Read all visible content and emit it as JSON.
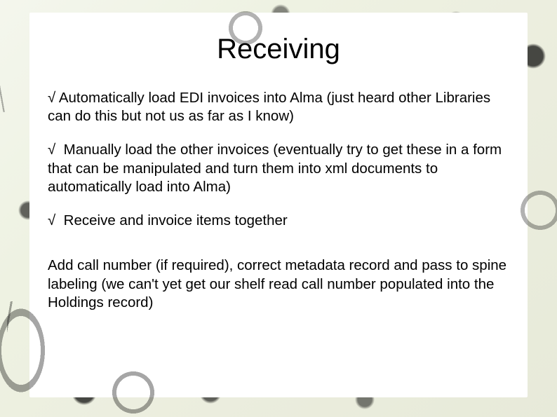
{
  "title": "Receiving",
  "bullets": {
    "check": "√",
    "b1": "Automatically load EDI invoices into Alma (just heard other Libraries can do this but not us as far as I know)",
    "b2": "Manually load the other invoices (eventually try to get these in a form that can be manipulated and turn them into xml documents to automatically load into Alma)",
    "b3": "Receive and invoice items together",
    "b4": "Add call number (if required), correct metadata record and pass to spine labeling (we can't yet get our shelf read call number populated into the Holdings record)"
  }
}
